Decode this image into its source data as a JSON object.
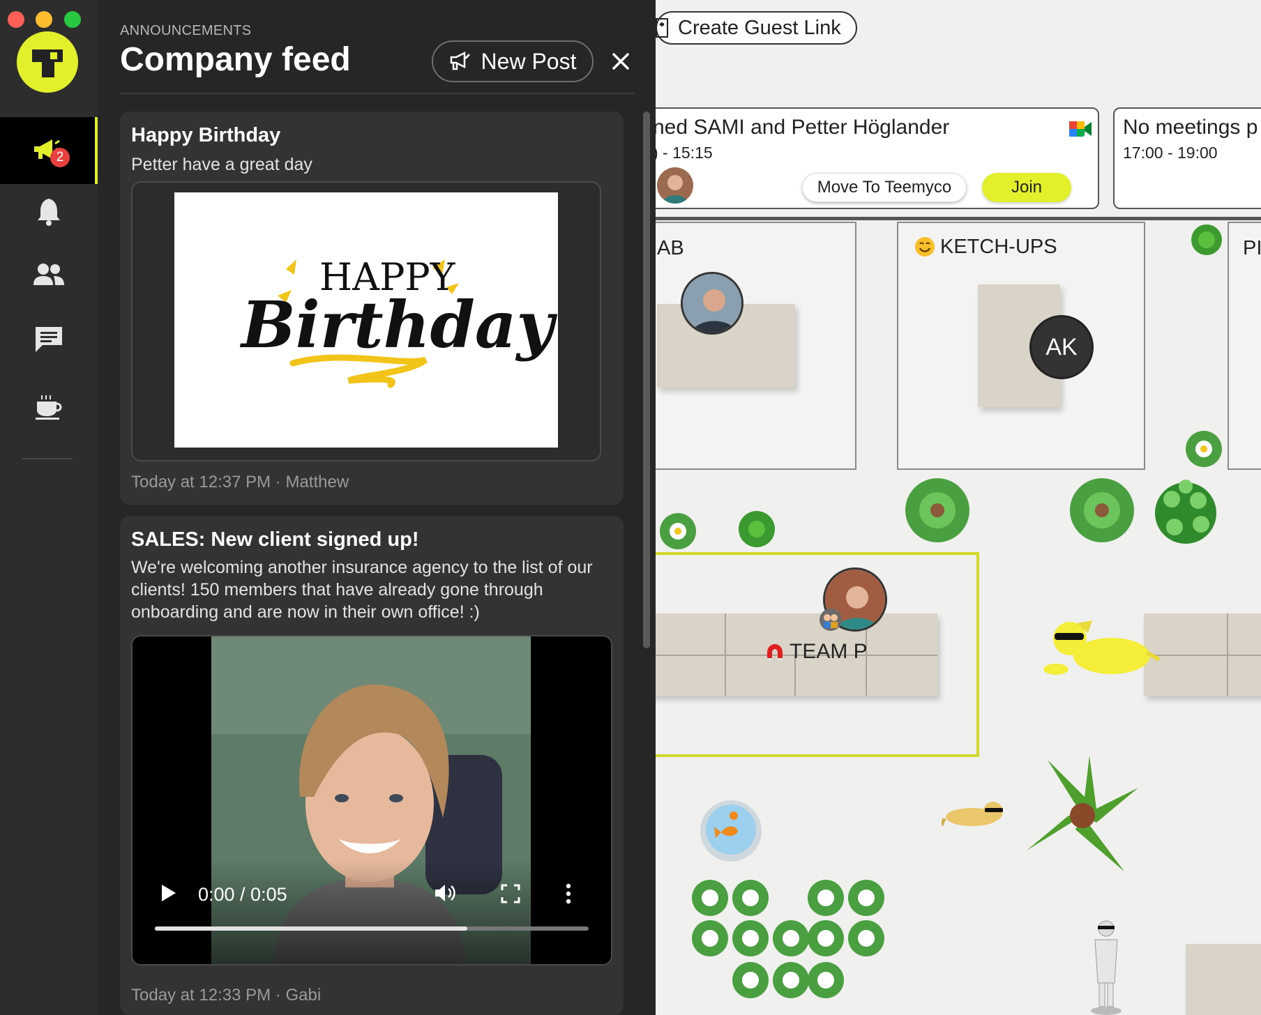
{
  "nav": {
    "announcement_badge": "2",
    "items": [
      {
        "icon": "megaphone-icon",
        "active": true
      },
      {
        "icon": "bell-icon",
        "active": false
      },
      {
        "icon": "people-icon",
        "active": false
      },
      {
        "icon": "chat-icon",
        "active": false
      },
      {
        "icon": "coffee-icon",
        "active": false
      }
    ]
  },
  "feed": {
    "eyebrow": "ANNOUNCEMENTS",
    "title": "Company feed",
    "new_post_label": "New Post",
    "close_icon": "close-icon",
    "posts": [
      {
        "title": "Happy Birthday",
        "body": "Petter have a great day",
        "image_text_top": "HAPPY",
        "image_text_main": "Birthday",
        "meta": "Today at 12:37 PM · Matthew"
      },
      {
        "title": "SALES: New client signed up!",
        "body": "We're welcoming another insurance agency to the list of our clients! 150 members that have already gone through onboarding and are now in their own office! :)",
        "video_time": "0:00 / 0:05",
        "video_progress": 0.72,
        "meta": "Today at 12:33 PM · Gabi"
      }
    ]
  },
  "map": {
    "guest_link_label": "Create Guest Link",
    "meetings": [
      {
        "title": "ned SAMI and Petter Höglander",
        "time": ") - 15:15",
        "move_label": "Move To Teemyco",
        "join_label": "Join"
      },
      {
        "title": "No meetings p",
        "time": "17:00 - 19:00"
      }
    ],
    "rooms": {
      "left": "AB",
      "ketchups": "KETCH-UPS",
      "right": "PI",
      "team": "TEAM P"
    },
    "ak_initials": "AK",
    "colors": {
      "accent": "#e2f02c",
      "badge": "#e64040",
      "panel": "#262626",
      "rail": "#2d2d2d"
    }
  }
}
